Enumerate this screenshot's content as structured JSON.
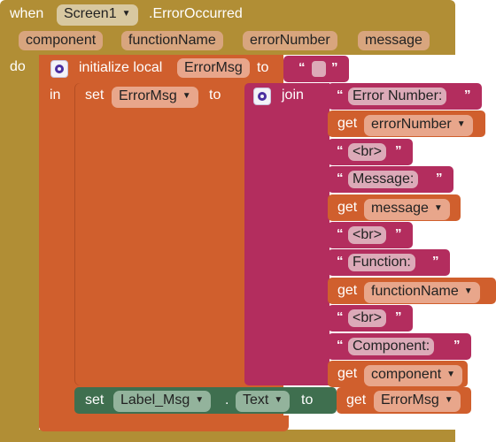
{
  "event": {
    "when_label": "when",
    "component_name": "Screen1",
    "event_name": ".ErrorOccurred",
    "do_label": "do",
    "params": [
      "component",
      "functionName",
      "errorNumber",
      "message"
    ]
  },
  "init_local": {
    "label": "initialize local",
    "var_name": "ErrorMsg",
    "to_label": "to",
    "in_label": "in",
    "initial_value": ""
  },
  "set_var": {
    "set_label": "set",
    "var_name": "ErrorMsg",
    "to_label": "to",
    "join_label": "join"
  },
  "join_items": [
    {
      "type": "text",
      "value": "Error Number:"
    },
    {
      "type": "get",
      "get_label": "get",
      "var": "errorNumber"
    },
    {
      "type": "text",
      "value": "<br>"
    },
    {
      "type": "text",
      "value": "Message:"
    },
    {
      "type": "get",
      "get_label": "get",
      "var": "message"
    },
    {
      "type": "text",
      "value": "<br>"
    },
    {
      "type": "text",
      "value": "Function:"
    },
    {
      "type": "get",
      "get_label": "get",
      "var": "functionName"
    },
    {
      "type": "text",
      "value": "<br>"
    },
    {
      "type": "text",
      "value": "Component:"
    },
    {
      "type": "get",
      "get_label": "get",
      "var": "component"
    }
  ],
  "set_label": {
    "set_label": "set",
    "component": "Label_Msg",
    "dot": ".",
    "property": "Text",
    "to_label": "to",
    "get_label": "get",
    "get_var": "ErrorMsg"
  },
  "colors": {
    "event": "#b18e35",
    "event_param": "#d8a57e",
    "variable": "#d05f2d",
    "variable_field": "#e8a68b",
    "text": "#b32d5e",
    "text_field": "#dcaab8",
    "component_set": "#3f6f4f",
    "component_field": "#93b39c",
    "mutator": "#4a2fa0"
  }
}
